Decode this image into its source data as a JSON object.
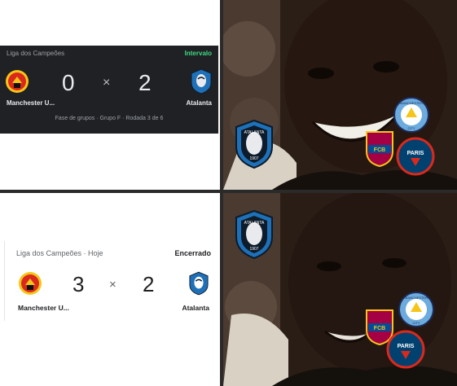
{
  "panel_top": {
    "league": "Liga dos Campeões",
    "status": "Intervalo",
    "home_team": "Manchester U...",
    "away_team": "Atalanta",
    "home_score": "0",
    "away_score": "2",
    "separator": "×",
    "stage": "Fase de grupos · Grupo F · Rodada 3 de 6"
  },
  "panel_bottom": {
    "league": "Liga dos Campeões · Hoje",
    "status": "Encerrado",
    "home_team": "Manchester U...",
    "away_team": "Atalanta",
    "home_score": "3",
    "away_score": "2",
    "separator": "×"
  },
  "badges": {
    "atalanta": {
      "name": "ATALANTA",
      "year": "1907"
    },
    "man_city": {
      "top": "MANCHESTER",
      "bottom": "CITY"
    },
    "psg": {
      "text": "PARIS"
    },
    "barca": {
      "text": "FCB"
    }
  },
  "colors": {
    "dark_card_bg": "#202124",
    "status_green": "#3ddc84",
    "divider": "#2a2a2a",
    "man_utd_red": "#da291c",
    "atalanta_blue": "#1e71b8",
    "city_blue": "#6cabdd",
    "psg_navy": "#004170",
    "barca_blue": "#a50044"
  },
  "icons": {
    "home_crest": "manchester-united-crest-icon",
    "away_crest": "atalanta-crest-icon"
  }
}
